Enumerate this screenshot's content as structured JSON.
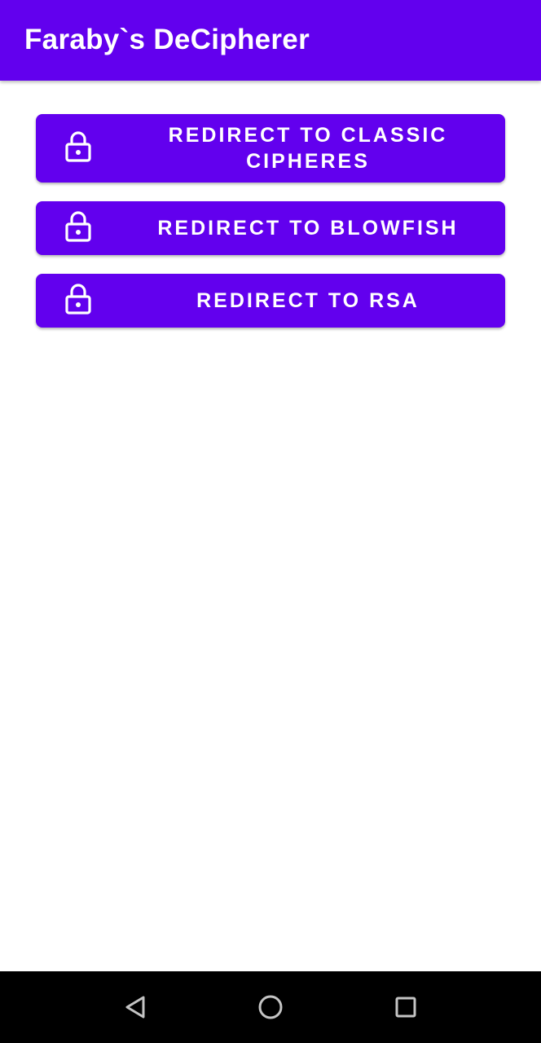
{
  "app_bar": {
    "title": "Faraby`s DeCipherer",
    "color": "#6200EE"
  },
  "buttons": [
    {
      "label": "REDIRECT TO CLASSIC CIPHERES",
      "icon": "lock-icon"
    },
    {
      "label": "REDIRECT TO BLOWFISH",
      "icon": "lock-icon"
    },
    {
      "label": "REDIRECT TO RSA",
      "icon": "lock-icon"
    }
  ],
  "nav_bar": {
    "back_icon": "back-triangle-icon",
    "home_icon": "home-circle-icon",
    "recents_icon": "recents-square-icon",
    "color": "#000000"
  },
  "colors": {
    "accent": "#6200EE",
    "background": "#FFFFFF",
    "on_accent": "#FFFFFF"
  }
}
